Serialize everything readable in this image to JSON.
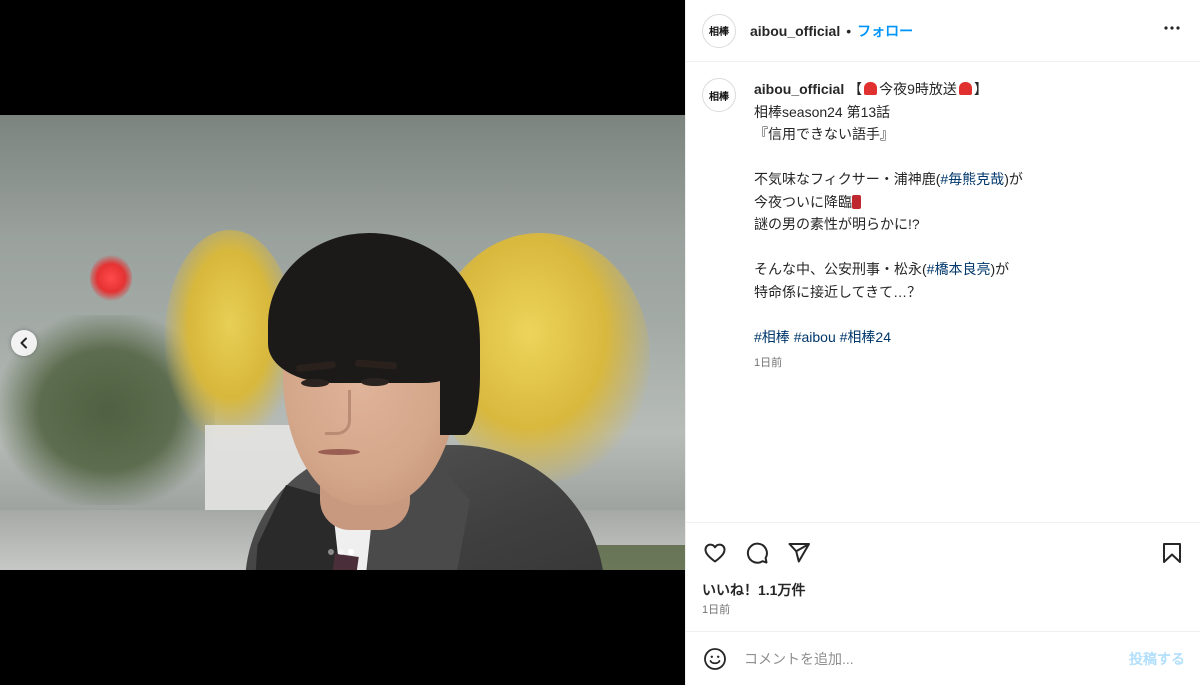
{
  "account": {
    "username": "aibou_official",
    "avatar_text": "相棒",
    "separator": "•",
    "follow_label": "フォロー",
    "more_label": "•••"
  },
  "media": {
    "carousel": {
      "total": 3,
      "active_index": 3
    },
    "prev_label": "‹"
  },
  "caption": {
    "username": "aibou_official",
    "line1_prefix": "【",
    "line1_text": "今夜9時放送",
    "line1_suffix": "】",
    "line2": "相棒season24 第13話",
    "line3": "『信用できない語手』",
    "line4_prefix": "不気味なフィクサー・浦神鹿(",
    "line4_tag": "#毎熊克哉",
    "line4_suffix": ")が",
    "line5": "今夜ついに降臨",
    "line6": "謎の男の素性が明らかに!?",
    "line7_prefix": "そんな中、公安刑事・松永(",
    "line7_tag": "#橋本良亮",
    "line7_suffix": ")が",
    "line8": "特命係に接近してきて…？",
    "hashtags": [
      "#相棒",
      "#aibou",
      "#相棒24"
    ],
    "time": "1日前"
  },
  "icons": {
    "like": "heart-icon",
    "comment": "comment-icon",
    "share": "send-icon",
    "save": "bookmark-icon",
    "emoji": "smile-icon"
  },
  "stats": {
    "likes": "いいね！1.1万件",
    "time": "1日前"
  },
  "comment": {
    "placeholder": "コメントを追加...",
    "post_label": "投稿する"
  },
  "colors": {
    "link": "#0095f6",
    "hashtag": "#00376b",
    "post_disabled": "#b2dffc"
  }
}
